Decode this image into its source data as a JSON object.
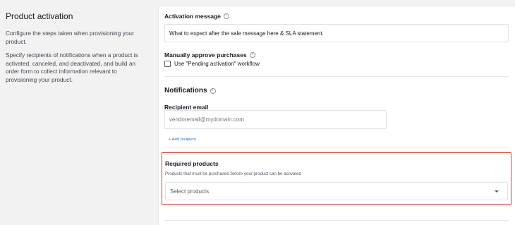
{
  "left": {
    "title": "Product activation",
    "desc1": "Configure the steps taken when provisioning your product.",
    "desc2": "Specify recipients of notifications when a product is activated, canceled, and deactivated, and build an order form to collect information relevant to provisioning your product."
  },
  "activation": {
    "label": "Activation message",
    "value": "What to expect after the sale message here & SLA statement."
  },
  "manual": {
    "label": "Manually approve purchases",
    "checkbox_label": "Use \"Pending activation\" workflow",
    "checked": false
  },
  "notifications": {
    "title": "Notifications",
    "recipient_label": "Recipient email",
    "recipient_placeholder": "vendoremail@mydomain.com",
    "add_link": "+ Add recipient"
  },
  "required": {
    "label": "Required products",
    "desc": "Products that must be purchased before your product can be activated",
    "select_placeholder": "Select products"
  },
  "icons": {
    "info": "info-icon",
    "dropdown": "chevron-down-icon"
  },
  "colors": {
    "highlight": "#d93a2b",
    "link": "#1a73c8"
  }
}
